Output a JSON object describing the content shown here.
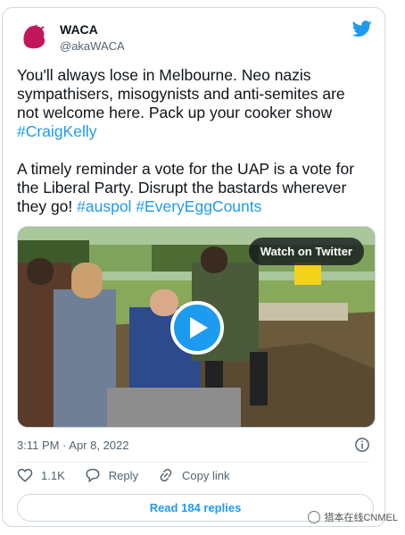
{
  "tweet": {
    "author_name": "WACA",
    "author_handle": "@akaWACA",
    "avatar_text": "WACA",
    "paragraph1_text": "You'll always lose in Melbourne. Neo nazis sympathisers, misogynists and anti-semites are not welcome here. Pack up your cooker show ",
    "paragraph1_tag": "#CraigKelly",
    "paragraph2_text": "A timely reminder a vote for the UAP is a vote for the Liberal Party. Disrupt the bastards wherever they go! ",
    "paragraph2_tags": [
      "#auspol",
      "#EveryEggCounts"
    ],
    "video_badge": "Watch on Twitter",
    "timestamp": "3:11 PM · Apr 8, 2022",
    "likes": "1.1K",
    "reply_label": "Reply",
    "copy_link_label": "Copy link",
    "read_replies_label": "Read 184 replies"
  },
  "watermark": {
    "text": "猎本在线CNMEL"
  },
  "colors": {
    "accent": "#1d9bf0",
    "muted": "#536471",
    "border": "#cfd9de",
    "avatar": "#c2185b"
  },
  "icons": [
    "twitter-bird-icon",
    "play-icon",
    "info-icon",
    "heart-icon",
    "reply-icon",
    "link-icon"
  ]
}
